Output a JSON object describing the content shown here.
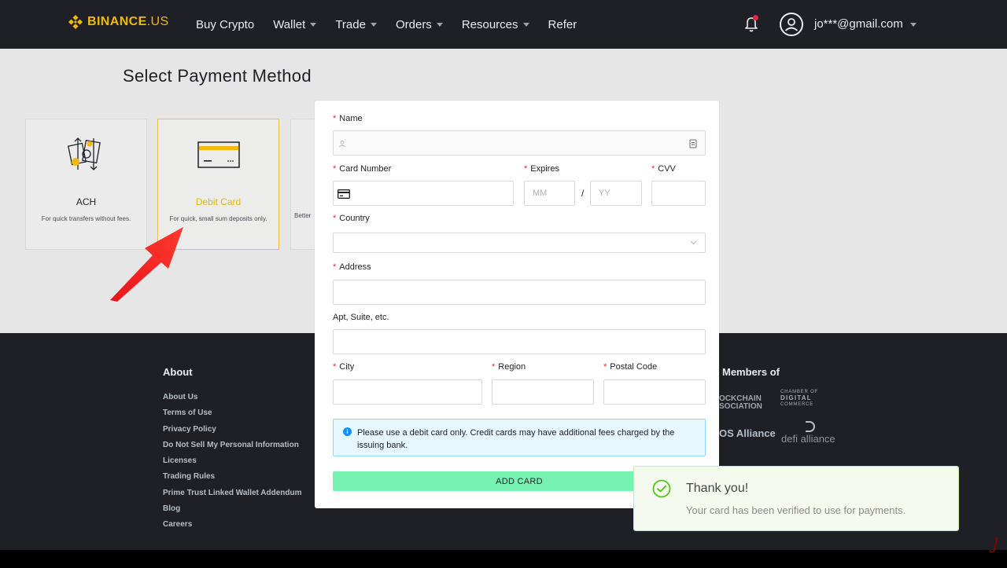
{
  "header": {
    "logo_text": "BINANCE",
    "logo_suffix": ".US",
    "nav": [
      {
        "label": "Buy Crypto",
        "dropdown": false
      },
      {
        "label": "Wallet",
        "dropdown": true
      },
      {
        "label": "Trade",
        "dropdown": true
      },
      {
        "label": "Orders",
        "dropdown": true
      },
      {
        "label": "Resources",
        "dropdown": true
      },
      {
        "label": "Refer",
        "dropdown": false
      }
    ],
    "user_email": "jo***@gmail.com",
    "notification_badge": true
  },
  "page": {
    "title": "Select Payment Method",
    "methods": [
      {
        "title": "ACH",
        "desc": "For quick transfers without fees.",
        "icon": "bank-transfer-icon",
        "selected": false
      },
      {
        "title": "Debit Card",
        "desc": "For quick, small sum deposits only.",
        "icon": "debit-card-icon",
        "selected": true
      },
      {
        "title": "",
        "desc": "Better",
        "icon": "",
        "selected": false
      }
    ]
  },
  "modal": {
    "name_label": "Name",
    "card_number_label": "Card Number",
    "expires_label": "Expires",
    "mm_placeholder": "MM",
    "yy_placeholder": "YY",
    "slash": "/",
    "cvv_label": "CVV",
    "country_label": "Country",
    "address_label": "Address",
    "apt_label": "Apt, Suite, etc.",
    "city_label": "City",
    "region_label": "Region",
    "postal_label": "Postal Code",
    "required_mark": "*",
    "info_text": "Please use a debit card only. Credit cards may have additional fees charged by the issuing bank.",
    "submit_label": "ADD CARD"
  },
  "footer": {
    "about_heading": "About",
    "about_links": [
      "About Us",
      "Terms of Use",
      "Privacy Policy",
      "Do Not Sell My Personal Information",
      "Licenses",
      "Trading Rules",
      "Prime Trust Linked Wallet Addendum",
      "Blog",
      "Careers"
    ],
    "members_heading": "Members of",
    "member_blockchain_1": "OCKCHAIN",
    "member_blockchain_2": "SOCIATION",
    "member_chamber_1": "CHAMBER OF",
    "member_chamber_2": "DIGITAL",
    "member_chamber_3": "COMMERCE",
    "member_eos": "OS Alliance",
    "member_defi": "defi alliance"
  },
  "toast": {
    "title": "Thank you!",
    "message": "Your card has been verified to use for payments."
  },
  "colors": {
    "brand_yellow": "#f0b90b",
    "header_bg": "#1e2026",
    "submit_green": "#77f2b0",
    "required_red": "#e0293c",
    "success_green": "#52c41a"
  }
}
